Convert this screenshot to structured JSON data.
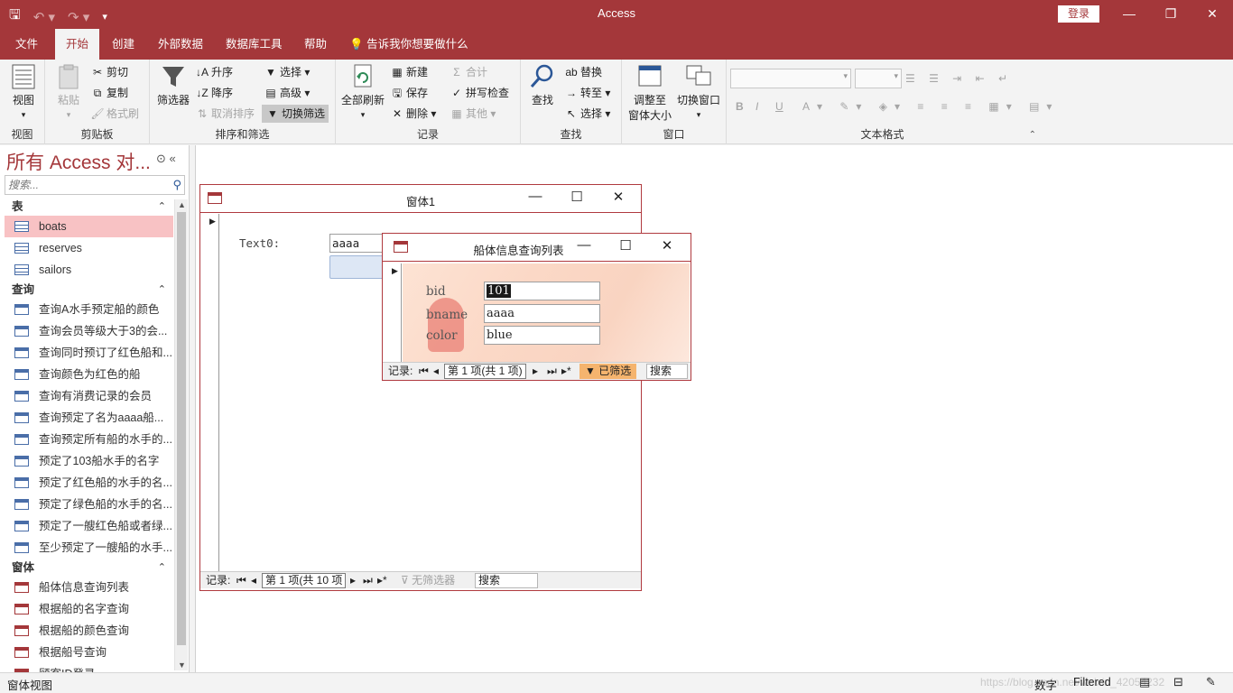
{
  "titlebar": {
    "title": "Access",
    "login": "登录",
    "qat_more": "▾"
  },
  "tabs": [
    "文件",
    "开始",
    "创建",
    "外部数据",
    "数据库工具",
    "帮助"
  ],
  "tell_me": "告诉我你想要做什么",
  "ribbon": {
    "views": {
      "label": "视图",
      "button": "视图"
    },
    "clipboard": {
      "label": "剪贴板",
      "paste": "粘贴",
      "cut": "剪切",
      "copy": "复制",
      "format_painter": "格式刷"
    },
    "sort_filter": {
      "label": "排序和筛选",
      "filter": "筛选器",
      "ascending": "升序",
      "descending": "降序",
      "remove_sort": "取消排序",
      "selection": "选择",
      "advanced": "高级",
      "toggle_filter": "切换筛选"
    },
    "records": {
      "label": "记录",
      "refresh_all": "全部刷新",
      "new": "新建",
      "save": "保存",
      "delete": "删除",
      "totals": "合计",
      "spelling": "拼写检查",
      "more": "其他"
    },
    "find": {
      "label": "查找",
      "find": "查找",
      "replace": "替换",
      "goto": "转至",
      "select": "选择"
    },
    "window": {
      "label": "窗口",
      "size_to_fit_1": "调整至",
      "size_to_fit_2": "窗体大小",
      "switch": "切换窗口"
    },
    "text_format": {
      "label": "文本格式",
      "bold": "B",
      "italic": "I",
      "underline": "U"
    }
  },
  "nav": {
    "title": "所有 Access 对...",
    "search_placeholder": "搜索...",
    "sections": [
      {
        "name": "表",
        "type": "table",
        "items": [
          "boats",
          "reserves",
          "sailors"
        ]
      },
      {
        "name": "查询",
        "type": "query",
        "items": [
          "查询A水手预定船的颜色",
          "查询会员等级大于3的会...",
          "查询同时预订了红色船和...",
          "查询颜色为红色的船",
          "查询有消费记录的会员",
          "查询预定了名为aaaa船...",
          "查询预定所有船的水手的...",
          "预定了103船水手的名字",
          "预定了红色船的水手的名...",
          "预定了绿色船的水手的名...",
          "预定了一艘红色船或者绿...",
          "至少预定了一艘船的水手..."
        ]
      },
      {
        "name": "窗体",
        "type": "form",
        "items": [
          "船体信息查询列表",
          "根据船的名字查询",
          "根据船的颜色查询",
          "根据船号查询",
          "顾客ID登录"
        ]
      }
    ],
    "selected": "boats"
  },
  "form1": {
    "title": "窗体1",
    "text_label": "Text0:",
    "text_value": "aaaa",
    "nav": {
      "record_label": "记录:",
      "position": "第 1 项(共 10 项",
      "filter": "无筛选器",
      "search": "搜索"
    }
  },
  "form2": {
    "title": "船体信息查询列表",
    "fields": [
      {
        "label": "bid",
        "value": "101"
      },
      {
        "label": "bname",
        "value": "aaaa"
      },
      {
        "label": "color",
        "value": "blue"
      }
    ],
    "nav": {
      "record_label": "记录:",
      "position": "第 1 项(共 1 项)",
      "filter": "已筛选",
      "search": "搜索"
    }
  },
  "statusbar": {
    "left": "窗体视图",
    "num": "数字",
    "filtered": "Filtered",
    "watermark": "https://blog.csdn.net/weixin_42054232"
  },
  "colors": {
    "accent": "#a4373a",
    "selected_nav": "#f8c2c4",
    "filter_on": "#f5b46e"
  }
}
